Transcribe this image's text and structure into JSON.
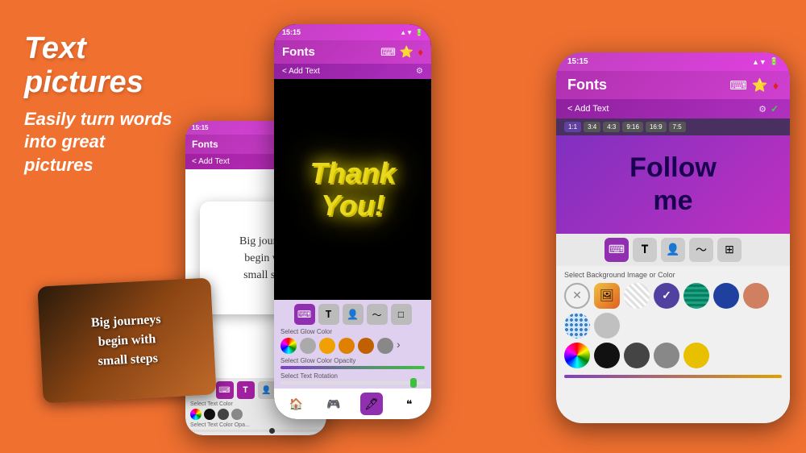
{
  "hero": {
    "title": "Text pictures",
    "subtitle": "Easily turn words\ninto great\npictures"
  },
  "card_white": {
    "text": "Big journeys\nbegin with\nsmall steps"
  },
  "card_dark": {
    "text": "Big journeys\nbegin with\nsmall steps"
  },
  "phone1": {
    "status": "15:15",
    "title": "Fonts",
    "add_text": "< Add Text",
    "sample_text": "Big journeys\nbegin with\nsmall steps",
    "color_label": "Select Text Color",
    "opacity_label": "Select Text Color Opa...",
    "colors": [
      "#e8d000",
      "#888",
      "#444",
      "#222"
    ]
  },
  "phone2": {
    "status": "15:15",
    "title": "Fonts",
    "add_text": "< Add Text",
    "canvas_text_line1": "Thank",
    "canvas_text_line2": "You!",
    "glow_label": "Select Glow Color",
    "opacity_label": "Select Glow Color Opacity",
    "rotation_label": "Select Text Rotation",
    "colors": [
      "#e040e0",
      "#aaa",
      "#f0a000",
      "#e08000",
      "#c06000",
      "#888"
    ],
    "nav": [
      "🏠",
      "🎮",
      "🖋",
      "❝"
    ]
  },
  "phone3": {
    "status": "15:15",
    "title": "Fonts",
    "add_text": "< Add Text",
    "ratios": [
      "1:1",
      "3:4",
      "4:3",
      "9:16",
      "16:9",
      "7:5"
    ],
    "active_ratio": "1:1",
    "canvas_text": "Follow\nme",
    "bg_label": "Select Background Image or Color",
    "bg_colors": [
      {
        "color": "#e0e0e0",
        "selected": false
      },
      {
        "color": "#5040a0",
        "selected": true
      },
      {
        "color": "#408040",
        "selected": false
      },
      {
        "color": "#2040a0",
        "selected": false
      },
      {
        "color": "#d08060",
        "selected": false
      },
      {
        "color": "#4080c0",
        "selected": false
      },
      {
        "color": "#c0c0c0",
        "selected": false
      },
      {
        "color": "#e8d000",
        "selected": false
      },
      {
        "color": "#c04040",
        "selected": false
      },
      {
        "color": "#202020",
        "selected": false
      },
      {
        "color": "#606060",
        "selected": false
      },
      {
        "color": "#909090",
        "selected": false
      }
    ]
  }
}
